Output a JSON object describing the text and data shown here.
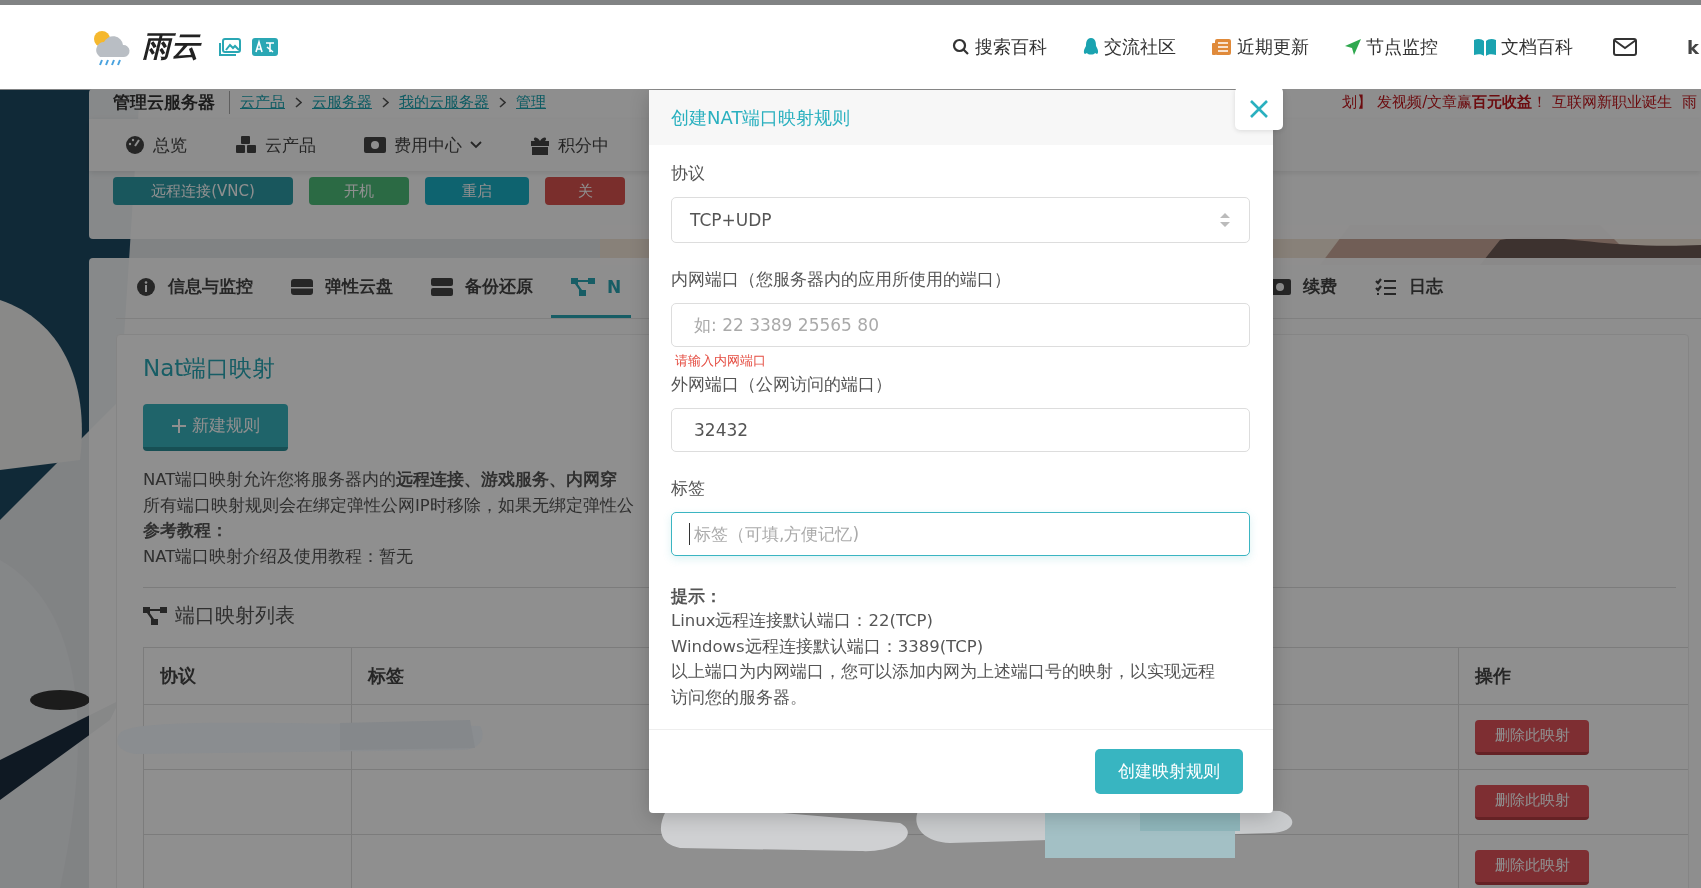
{
  "header": {
    "logo": "雨云",
    "nav": [
      {
        "label": "搜索百科"
      },
      {
        "label": "交流社区"
      },
      {
        "label": "近期更新"
      },
      {
        "label": "节点监控"
      },
      {
        "label": "文档百科"
      }
    ],
    "user": "k"
  },
  "server_card": {
    "title": "管理云服务器",
    "breadcrumb": [
      "云产品",
      "云服务器",
      "我的云服务器",
      "管理"
    ],
    "notice": "划】 发视频/文章赢**百元收益**！ 互联网新职业诞生",
    "notice_more": "雨",
    "menu": [
      {
        "label": "总览",
        "dropdown": false
      },
      {
        "label": "云产品",
        "dropdown": false
      },
      {
        "label": "费用中心",
        "dropdown": true
      },
      {
        "label": "积分中",
        "dropdown": false
      }
    ],
    "actions": [
      {
        "label": "远程连接(VNC)",
        "kind": "vnc"
      },
      {
        "label": "开机",
        "kind": "start"
      },
      {
        "label": "重启",
        "kind": "restart"
      },
      {
        "label": "关",
        "kind": "stop"
      }
    ]
  },
  "tabs": [
    {
      "label": "信息与监控",
      "selected": false
    },
    {
      "label": "弹性云盘",
      "selected": false
    },
    {
      "label": "备份还原",
      "selected": false
    },
    {
      "label": "N",
      "selected": true
    },
    {
      "label": "续费",
      "selected": false
    },
    {
      "label": "日志",
      "selected": false
    }
  ],
  "nat": {
    "title": "Nat端口映射",
    "new_button": "新建规则",
    "description": [
      "NAT端口映射允许您将服务器内的**远程连接、游戏服务、内网穿**",
      "所有端口映射规则会在绑定弹性公网IP时移除，如果无绑定弹性公"
    ],
    "tutorial_heading": "参考教程：",
    "tutorial": "NAT端口映射介绍及使用教程：暂无",
    "list_title": "端口映射列表",
    "table": {
      "columns": [
        "协议",
        "标签",
        "操作"
      ],
      "rows": [
        {
          "action": "删除此映射"
        },
        {
          "action": "删除此映射"
        },
        {
          "action": "删除此映射"
        }
      ]
    }
  },
  "modal": {
    "title": "创建NAT端口映射规则",
    "fields": [
      {
        "label": "协议",
        "kind": "select",
        "value": "TCP+UDP",
        "focused": false
      },
      {
        "label": "内网端口（您服务器内的应用所使用的端口）",
        "kind": "input",
        "placeholder": "如: 22 3389 25565 80",
        "error": "请输入内网端口",
        "focused": false
      },
      {
        "label": "外网端口（公网访问的端口）",
        "kind": "input",
        "value": "32432",
        "focused": false
      },
      {
        "label": "标签",
        "kind": "input",
        "placeholder": "标签（可填,方便记忆)",
        "focused": true
      }
    ],
    "tips_title": "提示：",
    "tips": [
      "Linux远程连接默认端口：22(TCP)",
      "Windows远程连接默认端口：3389(TCP)",
      "以上端口为内网端口，您可以添加内网为上述端口号的映射，以实现远程访问您的服务器。"
    ],
    "submit": "创建映射规则"
  }
}
